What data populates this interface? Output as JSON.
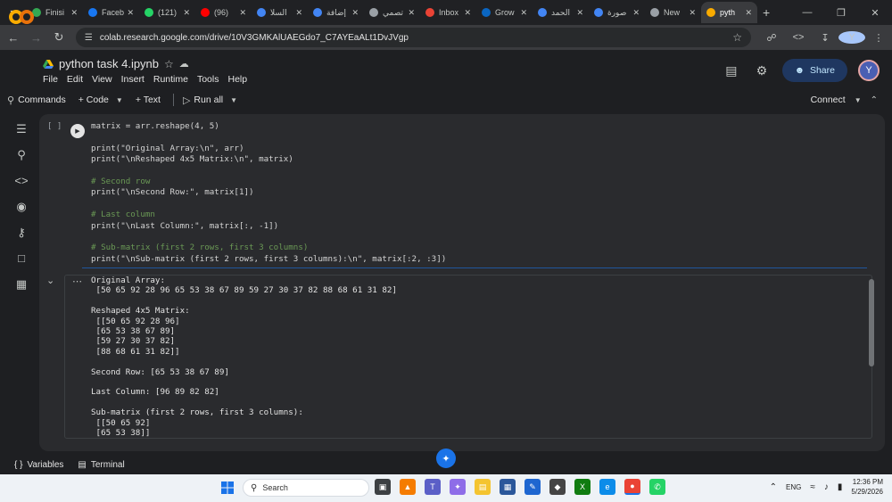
{
  "tabs": [
    {
      "label": "Finisi",
      "favicon_color": "#34a853",
      "icon": "check-circle-icon"
    },
    {
      "label": "Faceb",
      "favicon_color": "#1877f2",
      "icon": "facebook-icon"
    },
    {
      "label": "(121)",
      "favicon_color": "#25d366",
      "icon": "whatsapp-icon"
    },
    {
      "label": "(96)",
      "favicon_color": "#ff0000",
      "icon": "youtube-icon"
    },
    {
      "label": "السلا",
      "favicon_color": "#4285f4",
      "icon": "chat-icon"
    },
    {
      "label": "إضافة",
      "favicon_color": "#4285f4",
      "icon": "edit-icon"
    },
    {
      "label": "تصمي",
      "favicon_color": "#9aa0a6",
      "icon": "openai-icon"
    },
    {
      "label": "Inbox",
      "favicon_color": "#ea4335",
      "icon": "gmail-icon"
    },
    {
      "label": "Grow",
      "favicon_color": "#0a66c2",
      "icon": "linkedin-icon"
    },
    {
      "label": "الحمد",
      "favicon_color": "#4285f4",
      "icon": "edit-icon"
    },
    {
      "label": "صورة",
      "favicon_color": "#4285f4",
      "icon": "gemini-icon"
    },
    {
      "label": "New",
      "favicon_color": "#9aa0a6",
      "icon": "chrome-icon"
    },
    {
      "label": "pyth",
      "favicon_color": "#f9ab00",
      "icon": "colab-icon",
      "active": true
    }
  ],
  "address": {
    "url": "colab.research.google.com/drive/10V3GMKAlUAEGdo7_C7AYEaALt1DvJVgp",
    "profile_initial": "Y"
  },
  "notebook": {
    "title": "python task 4.ipynb",
    "menu": [
      "File",
      "Edit",
      "View",
      "Insert",
      "Runtime",
      "Tools",
      "Help"
    ],
    "share_label": "Share",
    "user_initial": "Y"
  },
  "toolbar": {
    "commands": "Commands",
    "code": "+ Code",
    "text": "+ Text",
    "run_all": "Run all",
    "connect": "Connect"
  },
  "cell": {
    "bracket": "[ ]",
    "code_lines": [
      "matrix = arr.reshape(4, 5)",
      "",
      "print(\"Original Array:\\n\", arr)",
      "print(\"\\nReshaped 4x5 Matrix:\\n\", matrix)",
      "",
      "# Second row",
      "print(\"\\nSecond Row:\", matrix[1])",
      "",
      "# Last column",
      "print(\"\\nLast Column:\", matrix[:, -1])",
      "",
      "# Sub-matrix (first 2 rows, first 3 columns)",
      "print(\"\\nSub-matrix (first 2 rows, first 3 columns):\\n\", matrix[:2, :3])"
    ]
  },
  "output": {
    "text": "Original Array:\n [50 65 92 28 96 65 53 38 67 89 59 27 30 37 82 88 68 61 31 82]\n\nReshaped 4x5 Matrix:\n [[50 65 92 28 96]\n [65 53 38 67 89]\n [59 27 30 37 82]\n [88 68 61 31 82]]\n\nSecond Row: [65 53 38 67 89]\n\nLast Column: [96 89 82 82]\n\nSub-matrix (first 2 rows, first 3 columns):\n [[50 65 92]\n [65 53 38]]"
  },
  "statusbar": {
    "variables": "Variables",
    "terminal": "Terminal"
  },
  "taskbar": {
    "search_placeholder": "Search",
    "language": "ENG",
    "time": "12:36 PM",
    "date": "5/29/2026"
  }
}
